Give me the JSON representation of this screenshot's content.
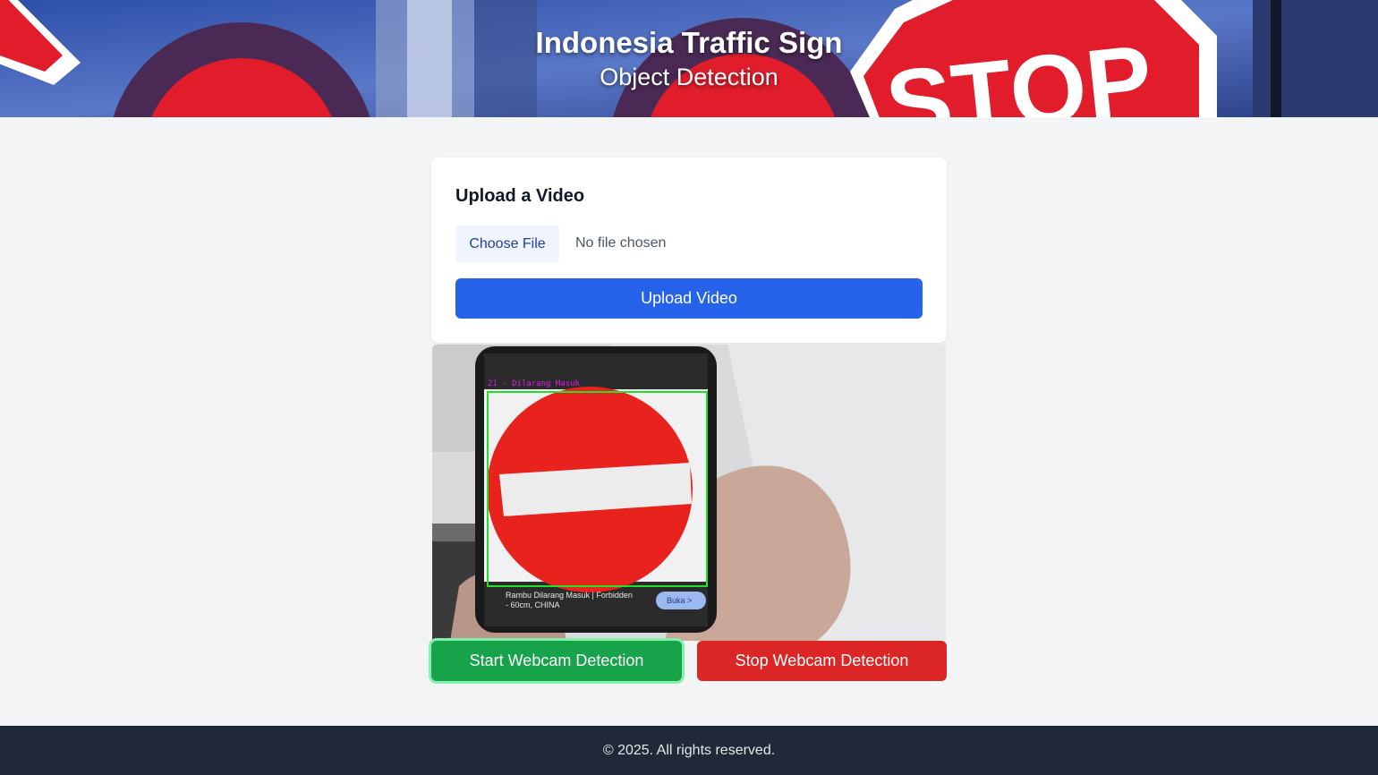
{
  "header": {
    "title": "Indonesia Traffic Sign",
    "subtitle": "Object Detection"
  },
  "upload": {
    "title": "Upload a Video",
    "choose_file_label": "Choose File",
    "file_status": "No file chosen",
    "upload_button_label": "Upload Video"
  },
  "video": {
    "detection_label": "21 - Dilarang Masuk",
    "phone_caption": "Rambu Dilarang Masuk | Forbidden",
    "phone_caption_2": "- 60cm, CHINA",
    "phone_button": "Buka >"
  },
  "webcam": {
    "start_label": "Start Webcam Detection",
    "stop_label": "Stop Webcam Detection"
  },
  "footer": {
    "text": "© 2025. All rights reserved."
  },
  "colors": {
    "primary": "#2563eb",
    "start": "#16a34a",
    "stop": "#dc2626",
    "footer_bg": "#1f2937",
    "detection_box": "#22e02a"
  }
}
